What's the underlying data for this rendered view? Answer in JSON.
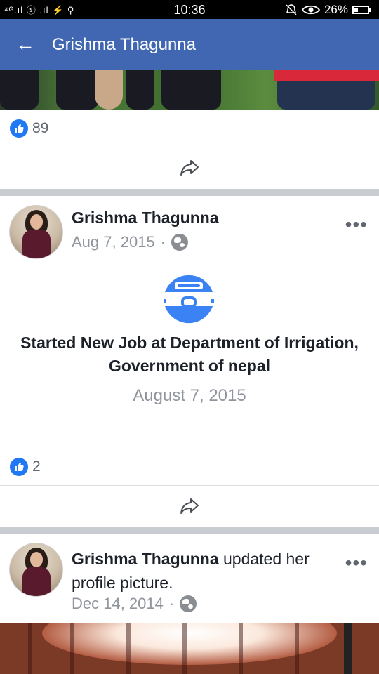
{
  "statusbar": {
    "signal_left": "⁴ᴳ.ıl ⓢ .ıl ⚡ ⚲",
    "time": "10:36",
    "battery_percent": "26%",
    "battery_level": 0.26
  },
  "header": {
    "back_icon": "←",
    "title": "Grishma Thagunna"
  },
  "top_post": {
    "like_count": "89"
  },
  "post1": {
    "author": "Grishma Thagunna",
    "date": "Aug 7, 2015",
    "dot": "·",
    "more": "•••",
    "event_title": "Started New Job at Department of Irrigation, Government of nepal",
    "event_date": "August 7, 2015",
    "like_count": "2"
  },
  "post2": {
    "author": "Grishma Thagunna",
    "action": "updated her profile picture.",
    "date": "Dec 14, 2014",
    "dot": "·",
    "more": "•••"
  },
  "colors": {
    "header_bg": "#4267b2",
    "like_blue": "#2078f4",
    "separator": "#c9ccd1"
  }
}
